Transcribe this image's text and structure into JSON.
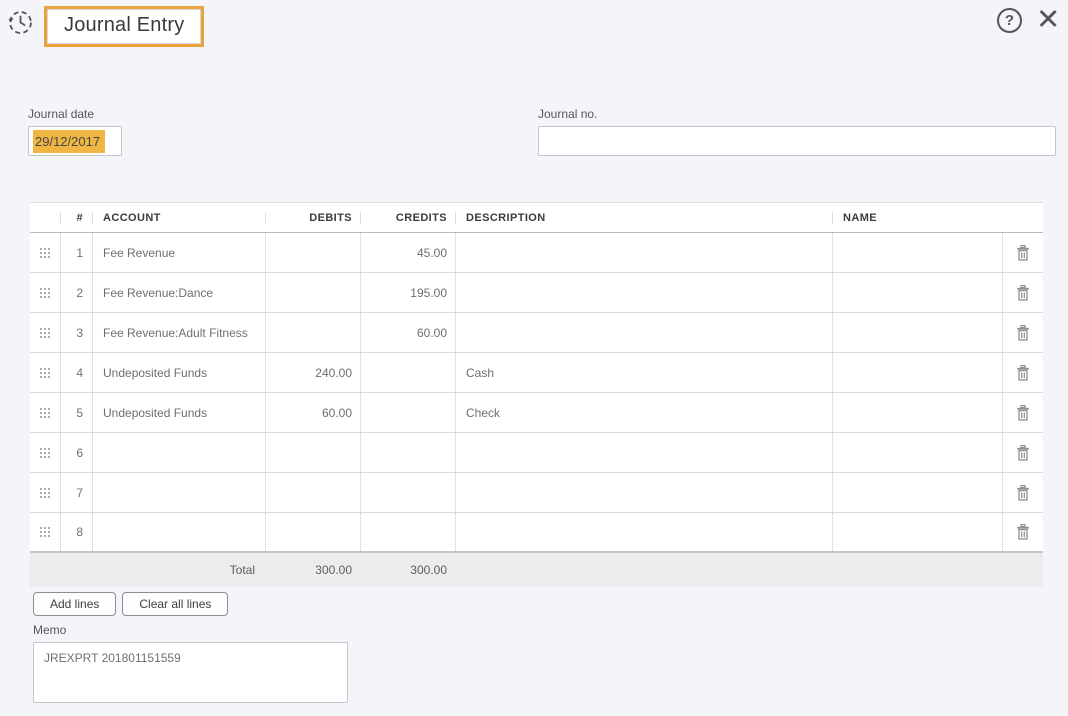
{
  "header": {
    "title": "Journal Entry",
    "help_glyph": "?",
    "close_glyph": "✕"
  },
  "form": {
    "journal_date": {
      "label": "Journal date",
      "value": "29/12/2017"
    },
    "journal_no": {
      "label": "Journal no.",
      "value": ""
    }
  },
  "table": {
    "columns": [
      "#",
      "ACCOUNT",
      "DEBITS",
      "CREDITS",
      "DESCRIPTION",
      "NAME"
    ],
    "rows": [
      {
        "num": "1",
        "account": "Fee Revenue",
        "debits": "",
        "credits": "45.00",
        "description": "",
        "name": ""
      },
      {
        "num": "2",
        "account": "Fee Revenue:Dance",
        "debits": "",
        "credits": "195.00",
        "description": "",
        "name": ""
      },
      {
        "num": "3",
        "account": "Fee Revenue:Adult Fitness",
        "debits": "",
        "credits": "60.00",
        "description": "",
        "name": ""
      },
      {
        "num": "4",
        "account": "Undeposited Funds",
        "debits": "240.00",
        "credits": "",
        "description": "Cash",
        "name": ""
      },
      {
        "num": "5",
        "account": "Undeposited Funds",
        "debits": "60.00",
        "credits": "",
        "description": "Check",
        "name": ""
      },
      {
        "num": "6",
        "account": "",
        "debits": "",
        "credits": "",
        "description": "",
        "name": ""
      },
      {
        "num": "7",
        "account": "",
        "debits": "",
        "credits": "",
        "description": "",
        "name": ""
      },
      {
        "num": "8",
        "account": "",
        "debits": "",
        "credits": "",
        "description": "",
        "name": ""
      }
    ],
    "total": {
      "label": "Total",
      "debits": "300.00",
      "credits": "300.00"
    }
  },
  "actions": {
    "add_lines": "Add lines",
    "clear_all_lines": "Clear all lines"
  },
  "memo": {
    "label": "Memo",
    "value": "JREXPRT 201801151559"
  },
  "colors": {
    "accent_border": "#e9a23c",
    "selection_highlight": "#efb642",
    "background": "#f4f5f8"
  }
}
